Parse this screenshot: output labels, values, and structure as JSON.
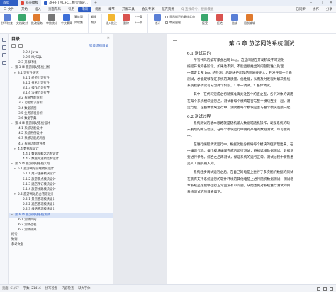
{
  "titlebar": {
    "tabs": [
      {
        "label": "首页",
        "color": "#2f5ec4"
      },
      {
        "label": "稻壳模板",
        "color": "#e0483c"
      },
      {
        "label": "基于HTML+C...框架旅游...",
        "color": "#2f5ec4"
      }
    ]
  },
  "menubar": {
    "file": "三 文件",
    "items": [
      "开始",
      "插入",
      "页面布局",
      "引用",
      "审阅",
      "视图",
      "章节",
      "开发工具",
      "会员专享",
      "稻壳资源"
    ],
    "active_index": 4,
    "search_placeholder": "Q 查找命令、搜索模板",
    "right_items": [
      "已同步",
      "协作",
      "分享"
    ]
  },
  "ribbon": {
    "buttons": [
      "拼写检查",
      "文档校对",
      "批改服务",
      "字数统计",
      "中文繁简"
    ],
    "group1": [
      "繁转简",
      "简转繁"
    ],
    "group2": [
      "翻译",
      "朗读"
    ],
    "group3": [
      "插入批注",
      "删除"
    ],
    "buttons2": [
      "上一条",
      "下一条"
    ],
    "group4": [
      "修订",
      "显示标记"
    ],
    "checks": [
      "显示标记的最终状态",
      "审阅窗格"
    ],
    "buttons3": [
      "接受",
      "拒绝",
      "上一条",
      "下一条",
      "比较",
      "限制编辑"
    ]
  },
  "nav": {
    "title": "目录",
    "ai_label": "智能识别目录",
    "items": [
      {
        "text": "2.2.4 Java",
        "level": 4
      },
      {
        "text": "2.2.5 MySQL",
        "level": 4
      },
      {
        "text": "2.3 开发环境",
        "level": 3
      },
      {
        "text": "第 3 章  旅游网站系统分析",
        "level": 1,
        "arrow": "▾"
      },
      {
        "text": "3.1 可行性研究",
        "level": 2,
        "arrow": "▾"
      },
      {
        "text": "3.1.1 经济上可行性",
        "level": 4
      },
      {
        "text": "3.1.2 技术上可行性",
        "level": 4
      },
      {
        "text": "3.1.3 操作上可行性",
        "level": 4
      },
      {
        "text": "3.1.4 法律上可行性",
        "level": 4
      },
      {
        "text": "3.2 系统性能分析",
        "level": 3
      },
      {
        "text": "3.3 功能需求分析",
        "level": 3
      },
      {
        "text": "3.4 数据流图",
        "level": 3
      },
      {
        "text": "3.5 业务流程分析",
        "level": 3
      },
      {
        "text": "3.6 数据字典",
        "level": 3
      },
      {
        "text": "第 4 章  旅游网站系统设计",
        "level": 1,
        "arrow": "▾"
      },
      {
        "text": "4.1 系统功能设计",
        "level": 3
      },
      {
        "text": "4.2 系统用例设计",
        "level": 3
      },
      {
        "text": "4.3 系统功能结构图",
        "level": 3
      },
      {
        "text": "4.3 系统功能时序图",
        "level": 3
      },
      {
        "text": "4.4 数据库设计",
        "level": 2,
        "arrow": "▾"
      },
      {
        "text": "4.4.1 数据库概念结构设计",
        "level": 4
      },
      {
        "text": "4.4.2 数据库逻辑结构设计",
        "level": 4
      },
      {
        "text": "第 5 章  旅游网站系统实现",
        "level": 1,
        "arrow": "▾"
      },
      {
        "text": "5.1 旅游网站前端模块设计",
        "level": 2,
        "arrow": "▾"
      },
      {
        "text": "5.1.1 用户注册模块设计",
        "level": 4
      },
      {
        "text": "5.1.2 旅游景点模块设计",
        "level": 4
      },
      {
        "text": "5.1.3 酒店预订模块设计",
        "level": 4
      },
      {
        "text": "5.1.4 旅游线路模块设计",
        "level": 4
      },
      {
        "text": "5.2 旅游网站后台管理设计",
        "level": 2,
        "arrow": "▾"
      },
      {
        "text": "5.2.1 景点管理模块设计",
        "level": 4
      },
      {
        "text": "5.2.2 酒店管理模块设计",
        "level": 4
      },
      {
        "text": "5.2.3 线路管理模块设计",
        "level": 4
      },
      {
        "text": "第 6 章  旅游网站系统测试",
        "level": 1,
        "arrow": "▾",
        "active": true
      },
      {
        "text": "6.1 测试目的",
        "level": 3
      },
      {
        "text": "6.2 测试过程",
        "level": 3
      },
      {
        "text": "6.3 测试效果",
        "level": 3
      },
      {
        "text": "结论",
        "level": 1
      },
      {
        "text": "致谢",
        "level": 1
      },
      {
        "text": "参考文献",
        "level": 1
      }
    ]
  },
  "document": {
    "chapter": "第 6 章  旅游网站系统测试",
    "h1": "6.1  测试目的",
    "p1": [
      "所有代码的编写都会出现 bug。这些问题在开发阶段不可避免",
      "编程开发的各阶段，如果达不到，不能直接推出的问题就难以处理",
      "中需定全部 bug 的检测。后期维护出现的影响要更大，开发任何一个系",
      "测试，才能足够保证系统的高质量、优性能，从而及时发现并解决系统",
      "系统程序调试可分为两个阶段，1.单一调试，2.整体调试。"
    ],
    "p2": [
      "其中，在代码完成之初就要准确关注各个的查之查，各个对象的调用",
      "在每个系统模块运行后，测试着每个模块是否与整个模块连接一起，测",
      "运行后，在整体模块运行中，测试着每个模块是否与整个模块连接一起"
    ],
    "h2": "6.2  测试过程",
    "p3": [
      "系统测试的基本思路就是随机输入数据或随机操作，发现系统的缺",
      "未发现的算法错误，在每个模块运行中要有严格的数据测试，尽可能的",
      "中。"
    ],
    "p4": [
      "在进行编程调试运行中，根据功能分析将每个模块的框架理出来，在",
      "中编译代码。每个模块编译完成后运行测试，随机选择数据测试。数据测",
      "要进行参考。综合之后再测试，保证系统的运行正常。测试过程中要熟悉",
      "是人工随机输入的。"
    ],
    "p5": [
      "系统经步调试运行之后，在自己的电脑上进行了多次随机数据的测试",
      "在装有支持系统运行的软件环境的其他电脑上进行随机数据测试，测试稳",
      "本系统是足能够运行正常且没有小问题。从而达到对系统进行测试的目",
      "系统测试的项目表如下。"
    ]
  },
  "statusbar": {
    "page": "页面: 61/67",
    "words": "字数: 21416",
    "spell": "拼写检查",
    "content_check": "内容检查",
    "missing_font": "缺失字体"
  }
}
